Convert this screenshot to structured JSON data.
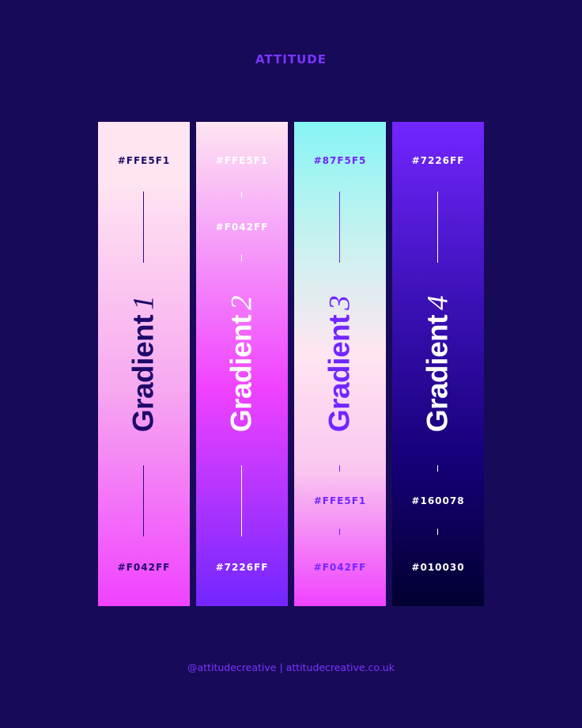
{
  "brand": "ATTITUDE",
  "footer": "@attitudecreative  |  attitudecreative.co.uk",
  "gradients": [
    {
      "title": "Gradient",
      "number": "1",
      "colors": [
        "#FFE5F1",
        "#F042FF"
      ],
      "text_color": "#1e0a6a",
      "rule_color": "#2a0f80"
    },
    {
      "title": "Gradient",
      "number": "2",
      "colors": [
        "#FFE5F1",
        "#F042FF",
        "#7226FF"
      ],
      "text_color": "#ffffff",
      "rule_color": "#ffffff"
    },
    {
      "title": "Gradient",
      "number": "3",
      "colors": [
        "#87F5F5",
        "#FFE5F1",
        "#F042FF"
      ],
      "text_color": "#7226ff",
      "rule_color": "#7226ff"
    },
    {
      "title": "Gradient",
      "number": "4",
      "colors": [
        "#7226FF",
        "#160078",
        "#010030"
      ],
      "text_color": "#ffffff",
      "rule_color": "#ffffff"
    }
  ]
}
